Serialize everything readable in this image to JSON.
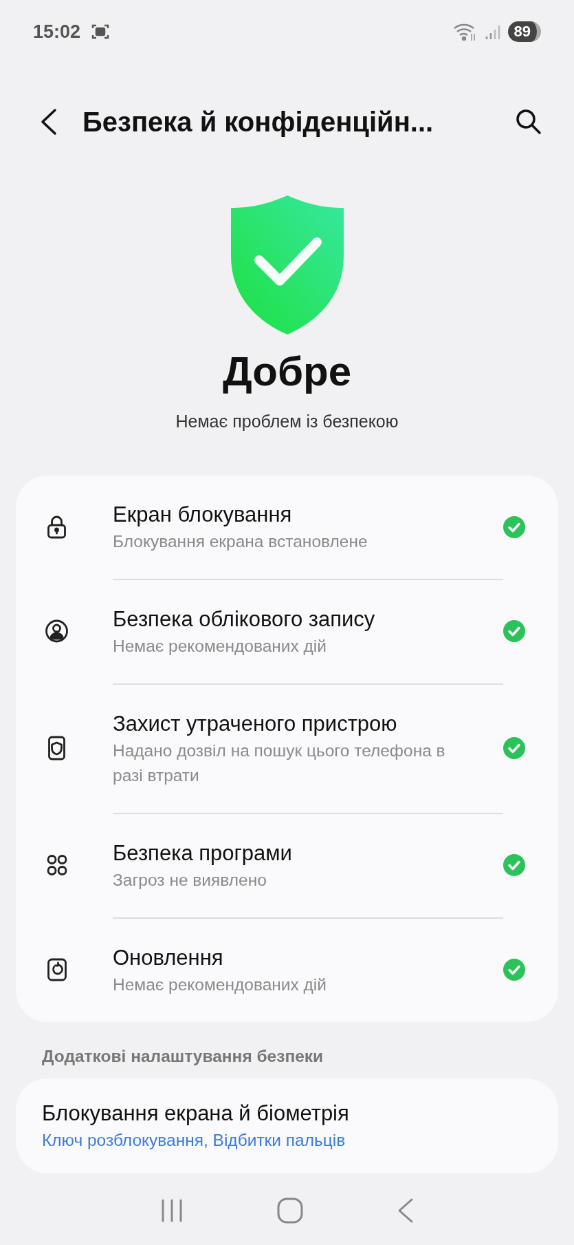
{
  "status_bar": {
    "time": "15:02",
    "battery": "89"
  },
  "header": {
    "title": "Безпека й конфіденційн..."
  },
  "summary": {
    "ok": true,
    "title": "Добре",
    "subtitle": "Немає проблем із безпекою"
  },
  "checks": [
    {
      "kind": "lock",
      "title": "Екран блокування",
      "subtitle": "Блокування екрана встановлене",
      "ok": true
    },
    {
      "kind": "account",
      "title": "Безпека облікового запису",
      "subtitle": "Немає рекомендованих дій",
      "ok": true
    },
    {
      "kind": "device",
      "title": "Захист утраченого пристрою",
      "subtitle": "Надано дозвіл на пошук цього телефона в разі втрати",
      "ok": true
    },
    {
      "kind": "apps",
      "title": "Безпека програми",
      "subtitle": "Загроз не виявлено",
      "ok": true
    },
    {
      "kind": "update",
      "title": "Оновлення",
      "subtitle": "Немає рекомендованих дій",
      "ok": true
    }
  ],
  "more": {
    "heading": "Додаткові налаштування безпеки",
    "items": [
      {
        "title": "Блокування екрана й біометрія",
        "subtitle": "Ключ розблокування, Відбитки пальців"
      }
    ]
  }
}
